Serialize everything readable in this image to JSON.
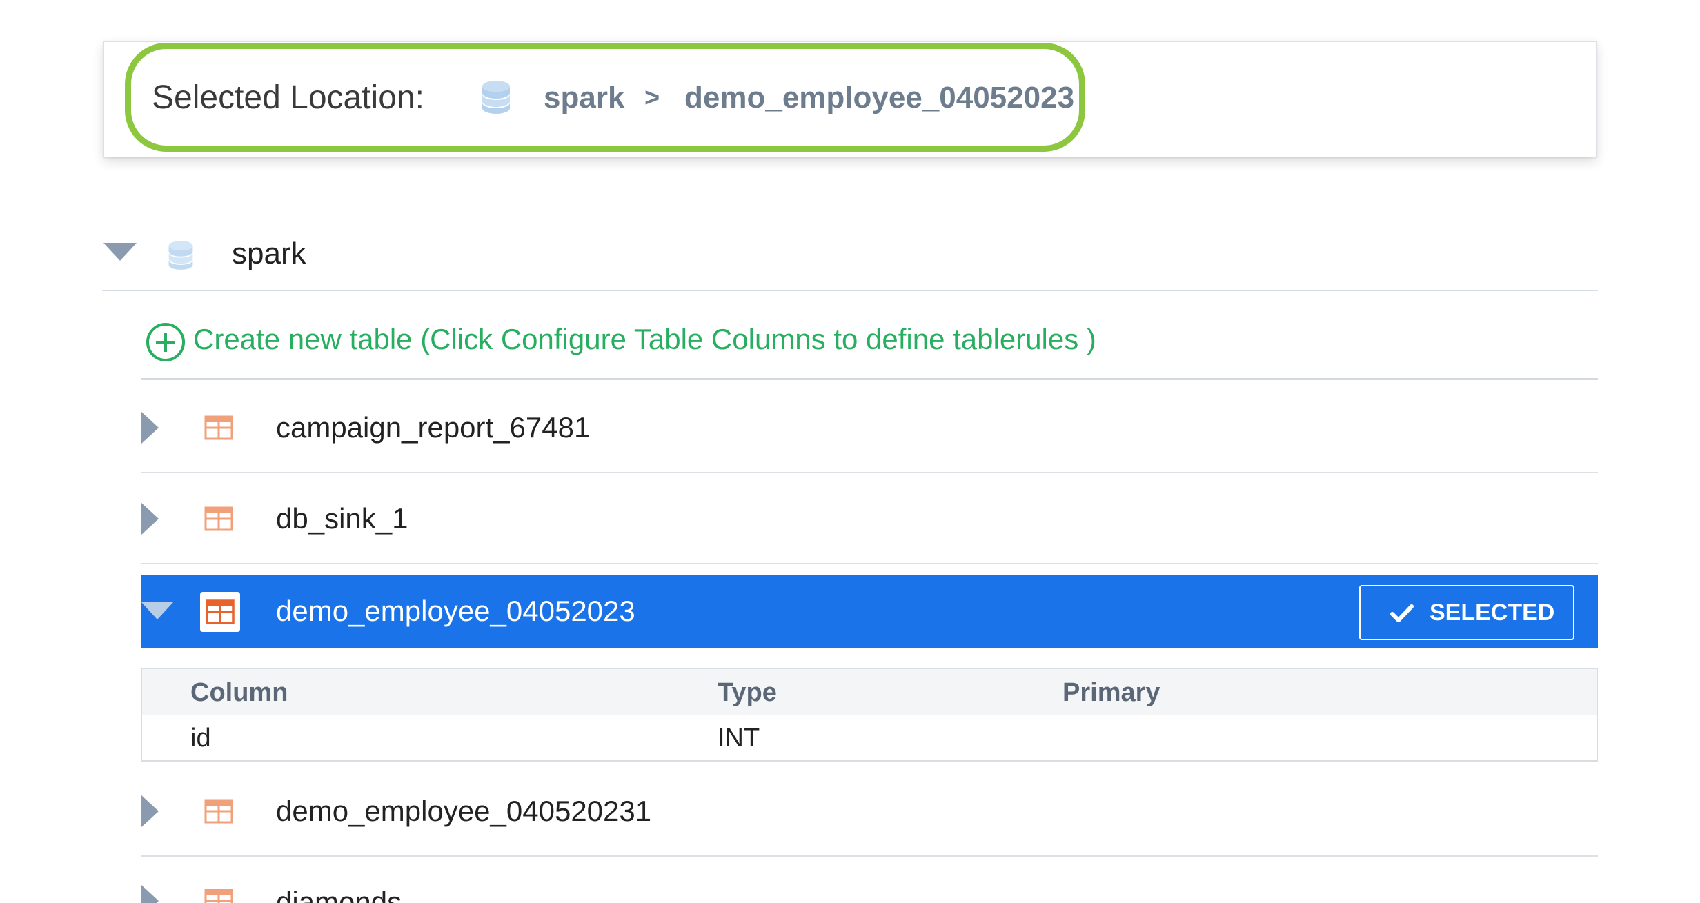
{
  "location": {
    "label": "Selected Location:",
    "database": "spark",
    "separator": ">",
    "table": "demo_employee_04052023"
  },
  "tree": {
    "root_label": "spark",
    "create_label": "Create new table (Click Configure Table Columns to define tablerules )",
    "tables": [
      {
        "name": "campaign_report_67481"
      },
      {
        "name": "db_sink_1"
      },
      {
        "name": "demo_employee_04052023",
        "selected": true
      },
      {
        "name": "demo_employee_040520231"
      },
      {
        "name": "diamonds"
      }
    ],
    "selected_badge": "SELECTED",
    "columns": {
      "headers": [
        "Column",
        "Type",
        "Primary"
      ],
      "rows": [
        [
          "id",
          "INT",
          ""
        ]
      ]
    }
  },
  "colors": {
    "highlight": "#8dc63f",
    "selected_bg": "#1a73e8",
    "create_green": "#27ae60",
    "table_icon": "#f0a07a"
  },
  "icons": {
    "database": "database-icon",
    "table": "table-icon",
    "add": "plus-circle-icon",
    "check": "check-icon"
  }
}
